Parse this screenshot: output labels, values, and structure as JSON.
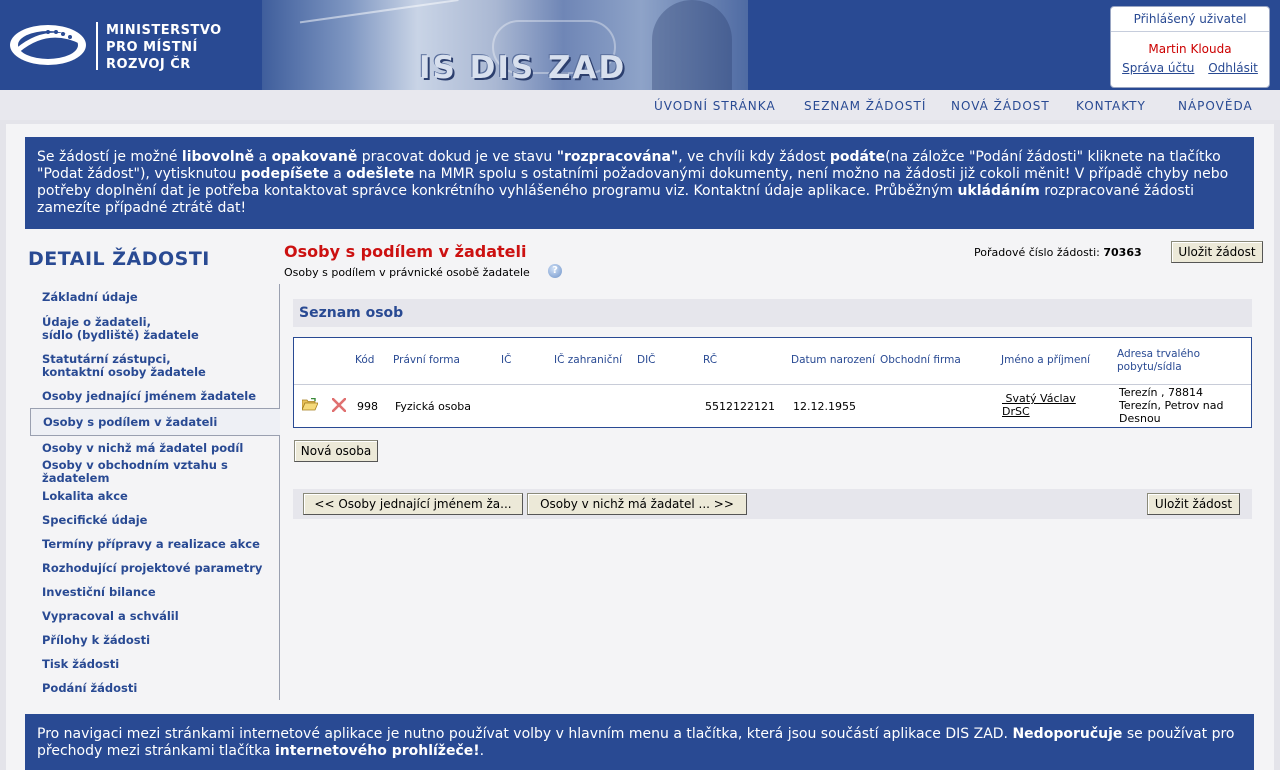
{
  "header": {
    "ministry_lines": [
      "MINISTERSTVO",
      "PRO MÍSTNÍ",
      "ROZVOJ ČR"
    ],
    "banner_title": "IS DIS ZAD",
    "user_box": {
      "label": "Přihlášený uživatel",
      "user_name": "Martin Klouda",
      "account_link": "Správa účtu",
      "logout_link": "Odhlásit"
    }
  },
  "nav": [
    "ÚVODNÍ STRÁNKA",
    "SEZNAM ŽÁDOSTÍ",
    "NOVÁ ŽÁDOST",
    "KONTAKTY",
    "NÁPOVĚDA"
  ],
  "info_top": {
    "t1": "Se žádostí je možné ",
    "b1": "libovolně",
    "t2": " a ",
    "b2": "opakovaně",
    "t3": " pracovat dokud je ve stavu ",
    "b3": "\"rozpracována\"",
    "t4": ", ve chvíli kdy žádost ",
    "b4": "podáte",
    "t5": "(na záložce \"Podání žádosti\" kliknete na tlačítko \"Podat žádost\"), vytisknutou ",
    "b5": "podepíšete",
    "t6": " a ",
    "b6": "odešlete",
    "t7": " na MMR spolu s ostatními požadovanými dokumenty, není možno na žádosti již cokoli měnit! V případě chyby nebo potřeby doplnění dat je potřeba kontaktovat správce konkrétního vyhlášeného programu viz. Kontaktní údaje aplikace. Průběžným ",
    "b7": "ukládáním",
    "t8": " rozpracované žádosti zamezíte případné ztrátě dat!"
  },
  "sidebar": {
    "title": "DETAIL ŽÁDOSTI",
    "items": [
      {
        "line1": "Základní údaje",
        "line2": ""
      },
      {
        "line1": "Údaje o žadateli,",
        "line2": "sídlo (bydliště) žadatele"
      },
      {
        "line1": "Statutární zástupci,",
        "line2": "kontaktní osoby žadatele"
      },
      {
        "line1": "Osoby jednající jménem žadatele",
        "line2": ""
      },
      {
        "line1": "Osoby s podílem v žadateli",
        "line2": ""
      },
      {
        "line1": "Osoby v nichž má žadatel podíl",
        "line2": ""
      },
      {
        "line1": "Osoby v obchodním vztahu s žadatelem",
        "line2": ""
      },
      {
        "line1": "Lokalita akce",
        "line2": ""
      },
      {
        "line1": "Specifické údaje",
        "line2": ""
      },
      {
        "line1": "Termíny přípravy a realizace akce",
        "line2": ""
      },
      {
        "line1": "Rozhodující projektové parametry",
        "line2": ""
      },
      {
        "line1": "Investiční bilance",
        "line2": ""
      },
      {
        "line1": "Vypracoval a schválil",
        "line2": ""
      },
      {
        "line1": "Přílohy k žádosti",
        "line2": ""
      },
      {
        "line1": "Tisk žádosti",
        "line2": ""
      },
      {
        "line1": "Podání žádosti",
        "line2": ""
      }
    ],
    "active_index": 4
  },
  "main": {
    "title": "Osoby s podílem v žadateli",
    "subtitle": "Osoby s podílem v právnické osobě žadatele",
    "help_glyph": "?",
    "order_label": "Pořadové číslo žádosti:",
    "order_number": "70363",
    "save_label": "Uložit žádost",
    "list_title": "Seznam osob",
    "columns": [
      "Kód",
      "Právní forma",
      "IČ",
      "IČ zahraniční",
      "DIČ",
      "RČ",
      "Datum narození",
      "Obchodní firma",
      "Jméno a příjmení",
      "Adresa trvalého pobytu/sídla"
    ],
    "rows": [
      {
        "kod": "998",
        "pravni_forma": "Fyzická osoba",
        "ic": "",
        "ic_zahranicni": "",
        "dic": "",
        "rc": "5512122121",
        "datum_narozeni": "12.12.1955",
        "obchodni_firma": "",
        "jmeno_line1": "Svatý Václav",
        "jmeno_line2": "DrSC",
        "adresa_line1": "Terezín , 78814",
        "adresa_line2": "Terezín, Petrov nad",
        "adresa_line3": "Desnou"
      }
    ],
    "new_person_label": "Nová osoba",
    "prev_label": "<<  Osoby jednající jménem ža...",
    "next_label": "Osoby v nichž má žadatel ...  >>",
    "save_bottom_label": "Uložit žádost"
  },
  "info_bottom": {
    "t1": "Pro navigaci mezi stránkami internetové aplikace je nutno používat volby v hlavním menu a tlačítka, která jsou součástí aplikace DIS ZAD. ",
    "b1": "Nedoporučuje",
    "t2": " se používat pro přechody mezi stránkami tlačítka ",
    "b2": "internetového prohlížeče!",
    "t3": "."
  },
  "colors": {
    "brand_blue": "#294a93",
    "title_red": "#cc1111",
    "delete_red": "#e07070"
  },
  "icons": {
    "open": "folder-open-icon",
    "delete": "delete-x-icon",
    "help": "help-icon"
  }
}
